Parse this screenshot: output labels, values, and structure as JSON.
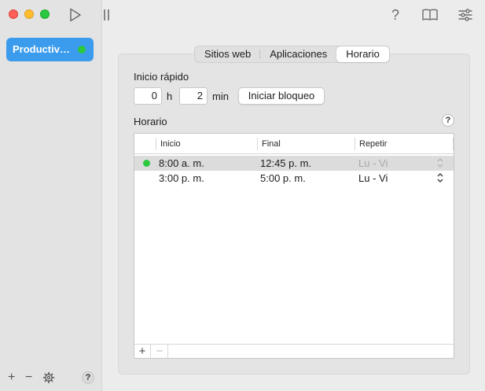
{
  "sidebar": {
    "items": [
      {
        "label": "Productividad",
        "status_color": "#2bc840"
      }
    ],
    "bottom": {
      "add": "+",
      "remove": "−",
      "help": "?"
    }
  },
  "toolbar": {
    "help": "?"
  },
  "tabs": [
    {
      "label": "Sitios web",
      "active": false
    },
    {
      "label": "Aplicaciones",
      "active": false
    },
    {
      "label": "Horario",
      "active": true
    }
  ],
  "quick_start": {
    "title": "Inicio rápido",
    "hours": "0",
    "hours_unit": "h",
    "minutes": "2",
    "minutes_unit": "min",
    "start_button": "Iniciar bloqueo"
  },
  "schedule": {
    "title": "Horario",
    "help": "?",
    "columns": [
      "Inicio",
      "Final",
      "Repetir"
    ],
    "rows": [
      {
        "start": "8:00 a. m.",
        "end": "12:45 p. m.",
        "repeat": "Lu - Vi",
        "active": true
      },
      {
        "start": "3:00 p. m.",
        "end": "5:00 p. m.",
        "repeat": "Lu - Vi",
        "active": false
      }
    ],
    "footer": {
      "add": "+",
      "remove": "−"
    }
  }
}
